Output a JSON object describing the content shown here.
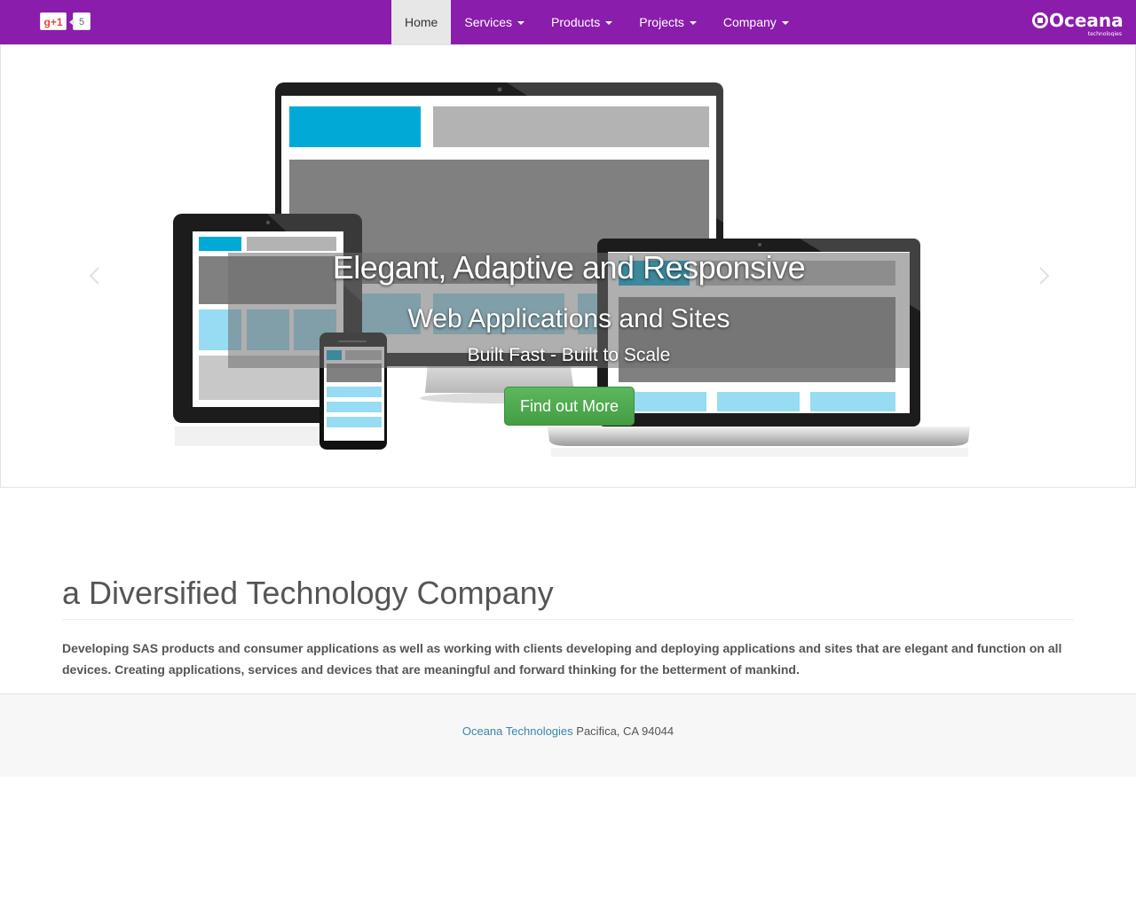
{
  "navbar": {
    "gplus_label": "g+1",
    "gplus_count": "5",
    "items": [
      {
        "label": "Home",
        "active": true
      },
      {
        "label": "Services",
        "dropdown": true
      },
      {
        "label": "Products",
        "dropdown": true
      },
      {
        "label": "Projects",
        "dropdown": true
      },
      {
        "label": "Company",
        "dropdown": true
      }
    ],
    "brand_name": "Oceana",
    "brand_sub": "technologies"
  },
  "carousel": {
    "title": "Elegant, Adaptive and Responsive",
    "subtitle": "Web Applications and Sites",
    "tagline": "Built Fast - Built to Scale",
    "cta_label": "Find out More",
    "prev_icon": "chevron-left-icon",
    "next_icon": "chevron-right-icon"
  },
  "main": {
    "heading": "a Diversified Technology Company",
    "lead": "Developing SAS products and consumer applications as well as working with clients developing and deploying applications and sites that are elegant and function on all devices. Creating applications, services and devices that are meaningful and forward thinking for the betterment of mankind."
  },
  "footer": {
    "company_link": "Oceana Technologies",
    "location": "Pacifica, CA 94044"
  },
  "colors": {
    "navbar_bg": "#8a1dab",
    "accent_blue": "#00a9d6",
    "cta_green": "#4aa34a"
  }
}
